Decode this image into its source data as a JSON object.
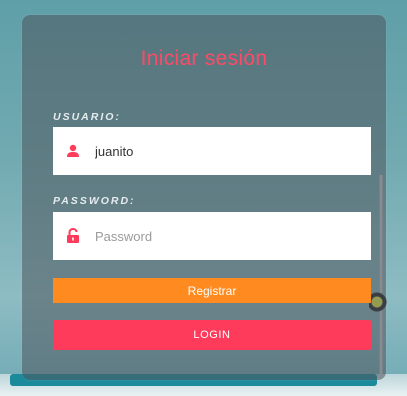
{
  "login": {
    "title": "Iniciar sesión",
    "username_label": "USUARIO:",
    "username_value": "juanito",
    "password_label": "PASSWORD:",
    "password_placeholder": "Password",
    "register_label": "Registrar",
    "login_label": "LOGIN"
  },
  "colors": {
    "accent": "#ff3b5c",
    "register": "#ff8a1f",
    "title": "#ff4a66"
  },
  "icons": {
    "user": "user-icon",
    "password": "unlock-icon"
  }
}
